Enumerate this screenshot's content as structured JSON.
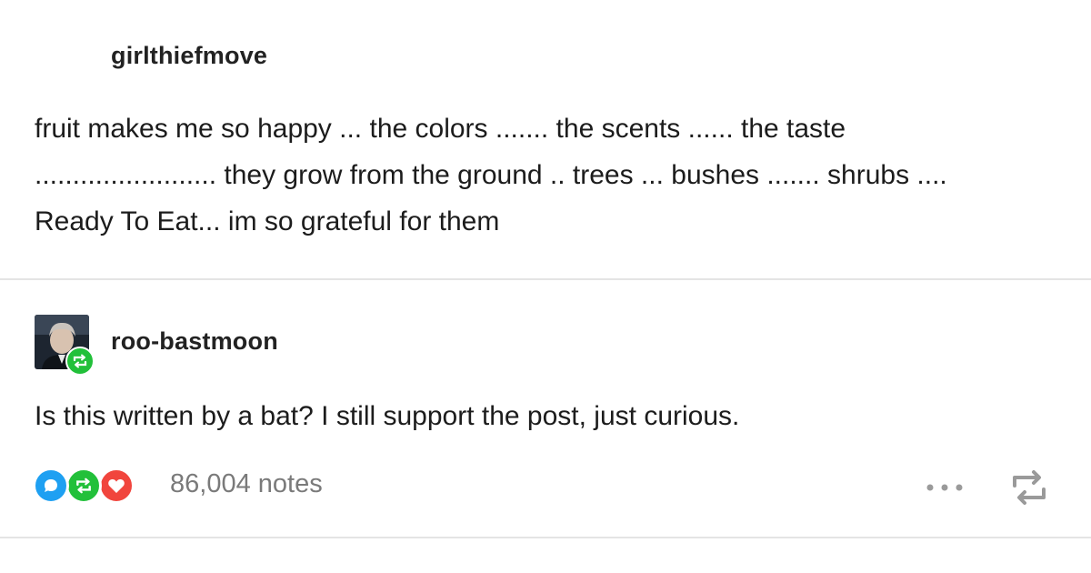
{
  "original_post": {
    "username": "girlthiefmove",
    "body_lines": [
      "fruit makes me so happy ... the colors ....... the scents ...... the taste",
      "........................ they grow from the ground .. trees ... bushes ....... shrubs ....",
      "Ready To Eat... im so grateful for them"
    ]
  },
  "reblog": {
    "username": "roo-bastmoon",
    "avatar_icon": "user-avatar",
    "badge_icon": "reblog-icon",
    "body": "Is this written by a bat? I still support the post, just curious."
  },
  "footer": {
    "note_icons": [
      "reply-icon",
      "reblog-icon",
      "heart-icon"
    ],
    "notes": "86,004 notes",
    "more_icon": "more-icon",
    "reblog_action_icon": "reblog-icon"
  },
  "colors": {
    "reply": "#1ea0f2",
    "reblog": "#22c03a",
    "like": "#f1453d",
    "notes_text": "#7a7a7a",
    "divider": "#e4e4e4"
  }
}
